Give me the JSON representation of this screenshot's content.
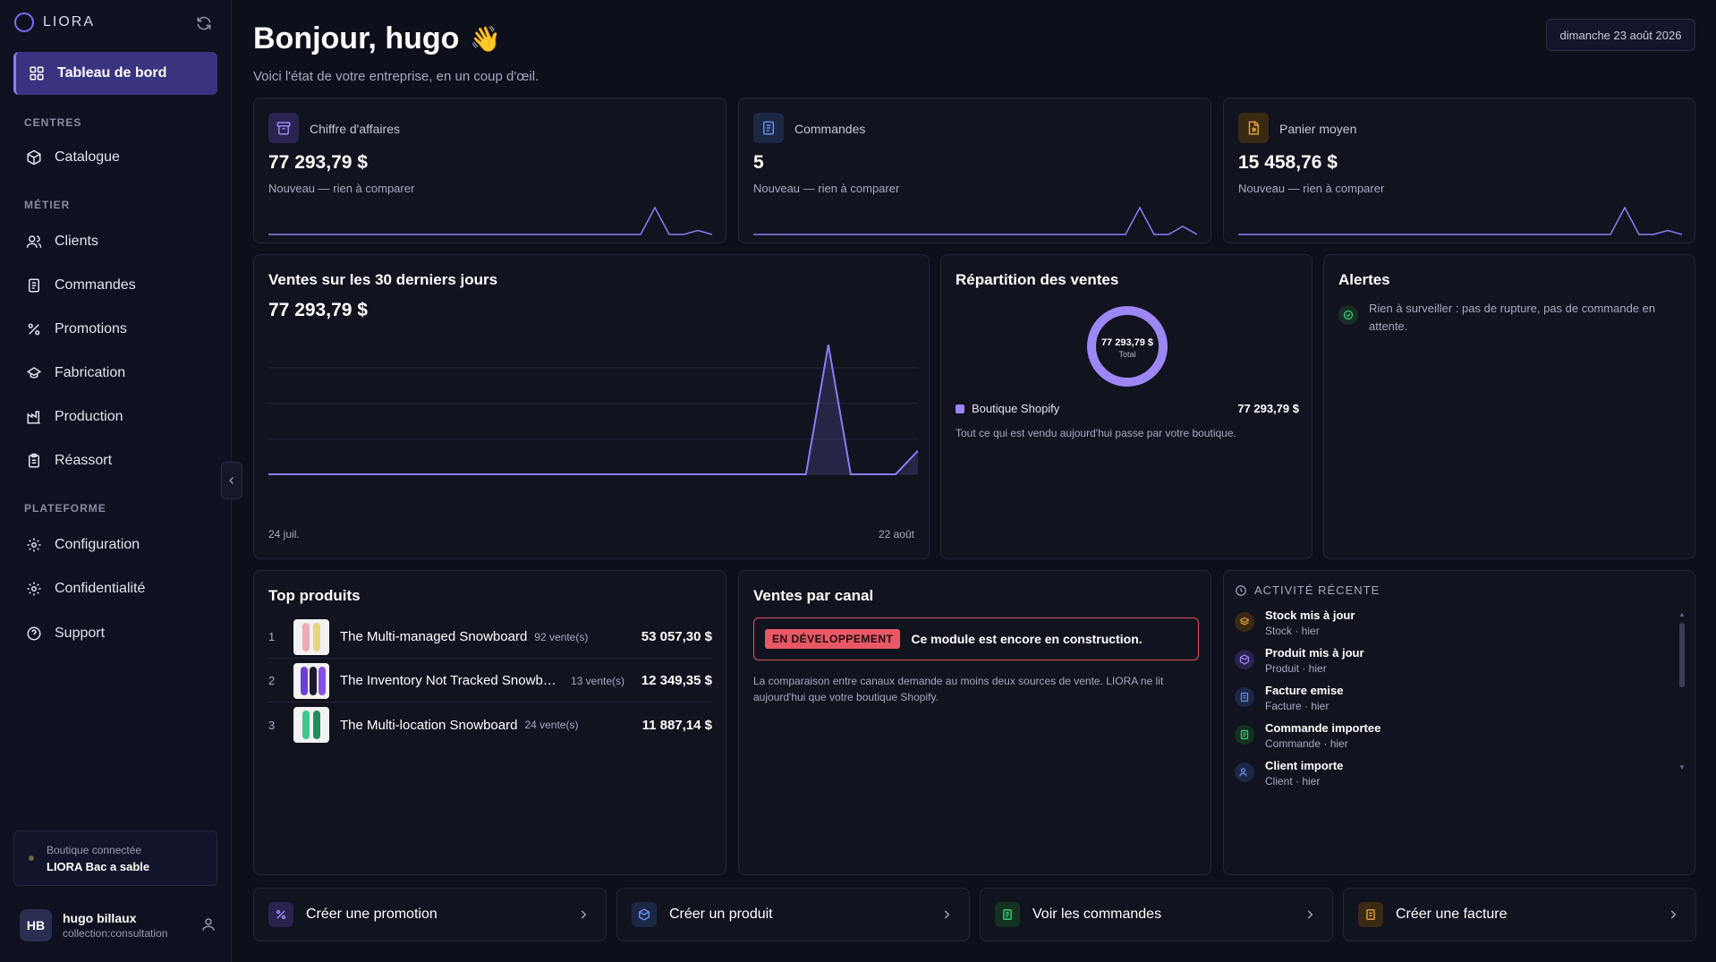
{
  "app": {
    "name": "LIORA"
  },
  "sidebar": {
    "active_item": "Tableau de bord",
    "sections": [
      {
        "title": "CENTRES",
        "items": [
          "Catalogue"
        ]
      },
      {
        "title": "MÉTIER",
        "items": [
          "Clients",
          "Commandes",
          "Promotions",
          "Fabrication",
          "Production",
          "Réassort"
        ]
      },
      {
        "title": "PLATEFORME",
        "items": [
          "Configuration",
          "Confidentialité",
          "Support"
        ]
      }
    ],
    "shop": {
      "label": "Boutique connectée",
      "name": "LIORA Bac a sable"
    },
    "user": {
      "initials": "HB",
      "name": "hugo billaux",
      "role": "collection:consultation"
    }
  },
  "header": {
    "greeting": "Bonjour, hugo",
    "wave": "👋",
    "subtitle": "Voici l'état de votre entreprise, en un coup d'œil.",
    "date": "dimanche 23 août 2026"
  },
  "kpis": [
    {
      "label": "Chiffre d'affaires",
      "value": "77 293,79 $",
      "note": "Nouveau — rien à comparer",
      "icon": "archive-icon",
      "color": "#8b7cf6",
      "spark": [
        0,
        0,
        0,
        0,
        0,
        0,
        0,
        0,
        0,
        0,
        0,
        0,
        0,
        0,
        0,
        0,
        0,
        0,
        0,
        0,
        0,
        0,
        0,
        0,
        0,
        0,
        0,
        1,
        0,
        0,
        0.15,
        0
      ]
    },
    {
      "label": "Commandes",
      "value": "5",
      "note": "Nouveau — rien à comparer",
      "icon": "document-icon",
      "color": "#6e8ee8",
      "spark": [
        0,
        0,
        0,
        0,
        0,
        0,
        0,
        0,
        0,
        0,
        0,
        0,
        0,
        0,
        0,
        0,
        0,
        0,
        0,
        0,
        0,
        0,
        0,
        0,
        0,
        0,
        0,
        1,
        0,
        0,
        0.3,
        0
      ]
    },
    {
      "label": "Panier moyen",
      "value": "15 458,76 $",
      "note": "Nouveau — rien à comparer",
      "icon": "file-dollar-icon",
      "color": "#e0a03a",
      "spark": [
        0,
        0,
        0,
        0,
        0,
        0,
        0,
        0,
        0,
        0,
        0,
        0,
        0,
        0,
        0,
        0,
        0,
        0,
        0,
        0,
        0,
        0,
        0,
        0,
        0,
        0,
        0,
        1,
        0,
        0,
        0.15,
        0
      ]
    }
  ],
  "sales30": {
    "title": "Ventes sur les 30 derniers jours",
    "total": "77 293,79 $",
    "x_start": "24 juil.",
    "x_end": "22 août"
  },
  "chart_data": {
    "type": "area",
    "title": "Ventes sur les 30 derniers jours",
    "x": [
      "24 juil.",
      "25 juil.",
      "26 juil.",
      "27 juil.",
      "28 juil.",
      "29 juil.",
      "30 juil.",
      "31 juil.",
      "1 août",
      "2 août",
      "3 août",
      "4 août",
      "5 août",
      "6 août",
      "7 août",
      "8 août",
      "9 août",
      "10 août",
      "11 août",
      "12 août",
      "13 août",
      "14 août",
      "15 août",
      "16 août",
      "17 août",
      "18 août",
      "19 août",
      "20 août",
      "21 août",
      "22 août"
    ],
    "series": [
      {
        "values": [
          0,
          0,
          0,
          0,
          0,
          0,
          0,
          0,
          0,
          0,
          0,
          0,
          0,
          0,
          0,
          0,
          0,
          0,
          0,
          0,
          0,
          0,
          0,
          0,
          0,
          65406,
          0,
          0,
          0,
          11887
        ]
      }
    ],
    "ylim": [
      0,
      70000
    ],
    "grid": true,
    "color": "#8b7cf6"
  },
  "repartition": {
    "title": "Répartition des ventes",
    "donut_value": "77 293,79 $",
    "donut_label": "Total",
    "legend": [
      {
        "name": "Boutique Shopify",
        "value": "77 293,79 $",
        "color": "#9c87f5"
      }
    ],
    "note": "Tout ce qui est vendu aujourd'hui passe par votre boutique."
  },
  "alerts": {
    "title": "Alertes",
    "message": "Rien à surveiller : pas de rupture, pas de commande en attente."
  },
  "top_products": {
    "title": "Top produits",
    "items": [
      {
        "rank": "1",
        "name": "The Multi-managed Snowboard",
        "count": "92 vente(s)",
        "amount": "53 057,30 $"
      },
      {
        "rank": "2",
        "name": "The Inventory Not Tracked Snowboard",
        "count": "13 vente(s)",
        "amount": "12 349,35 $"
      },
      {
        "rank": "3",
        "name": "The Multi-location Snowboard",
        "count": "24 vente(s)",
        "amount": "11 887,14 $"
      }
    ]
  },
  "channels": {
    "title": "Ventes par canal",
    "badge": "EN DÉVELOPPEMENT",
    "message": "Ce module est encore en construction.",
    "description": "La comparaison entre canaux demande au moins deux sources de vente. LIORA ne lit aujourd'hui que votre boutique Shopify."
  },
  "activity": {
    "title": "ACTIVITÉ RÉCENTE",
    "items": [
      {
        "title": "Stock mis à jour",
        "sub": "Stock · hier",
        "icon": "stack-icon",
        "color": "#e0a03a",
        "bg": "#3a2a14"
      },
      {
        "title": "Produit mis à jour",
        "sub": "Produit · hier",
        "icon": "box-icon",
        "color": "#9c87f5",
        "bg": "#2a2350"
      },
      {
        "title": "Facture emise",
        "sub": "Facture · hier",
        "icon": "invoice-icon",
        "color": "#6e8ee8",
        "bg": "#1c2746"
      },
      {
        "title": "Commande importee",
        "sub": "Commande · hier",
        "icon": "order-icon",
        "color": "#3ecf7c",
        "bg": "#143222"
      },
      {
        "title": "Client importe",
        "sub": "Client · hier",
        "icon": "users-icon",
        "color": "#6e8ee8",
        "bg": "#1c2746"
      }
    ]
  },
  "actions": [
    {
      "label": "Créer une promotion",
      "icon": "percent-icon",
      "color": "#9c87f5",
      "bg": "#2a2350"
    },
    {
      "label": "Créer un produit",
      "icon": "box-icon",
      "color": "#6e8ee8",
      "bg": "#1c2746"
    },
    {
      "label": "Voir les commandes",
      "icon": "order-icon",
      "color": "#3ecf7c",
      "bg": "#143222"
    },
    {
      "label": "Créer une facture",
      "icon": "invoice-icon",
      "color": "#e0a03a",
      "bg": "#3a2a14"
    }
  ]
}
